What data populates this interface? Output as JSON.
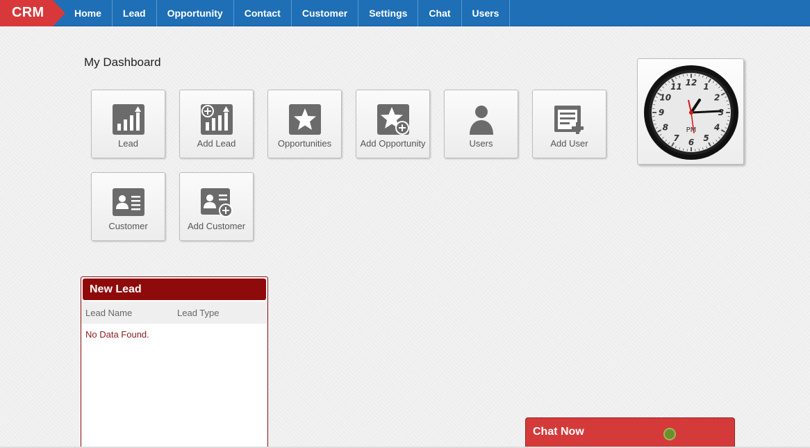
{
  "brand": "CRM",
  "nav": [
    "Home",
    "Lead",
    "Opportunity",
    "Contact",
    "Customer",
    "Settings",
    "Chat",
    "Users"
  ],
  "dashboard": {
    "title": "My Dashboard",
    "tiles": [
      {
        "label": "Lead",
        "icon": "lead-chart-icon"
      },
      {
        "label": "Add Lead",
        "icon": "add-lead-icon"
      },
      {
        "label": "Opportunities",
        "icon": "star-icon"
      },
      {
        "label": "Add Opportunity",
        "icon": "add-star-icon"
      },
      {
        "label": "Users",
        "icon": "user-icon"
      },
      {
        "label": "Add User",
        "icon": "add-user-icon"
      },
      {
        "label": "Customer",
        "icon": "id-card-icon"
      },
      {
        "label": "Add Customer",
        "icon": "add-id-card-icon"
      }
    ]
  },
  "clock": {
    "period": "PM",
    "numerals": [
      "12",
      "1",
      "2",
      "3",
      "4",
      "5",
      "6",
      "7",
      "8",
      "9",
      "10",
      "11"
    ]
  },
  "new_lead": {
    "title": "New Lead",
    "columns": [
      "Lead Name",
      "Lead Type"
    ],
    "empty_message": "No Data Found."
  },
  "chat": {
    "label": "Chat Now",
    "status_color": "#6b8f2a"
  },
  "colors": {
    "nav": "#1e6fb5",
    "brand": "#d9383a",
    "panel": "#8f0a0a",
    "chat": "#d43a3a"
  }
}
